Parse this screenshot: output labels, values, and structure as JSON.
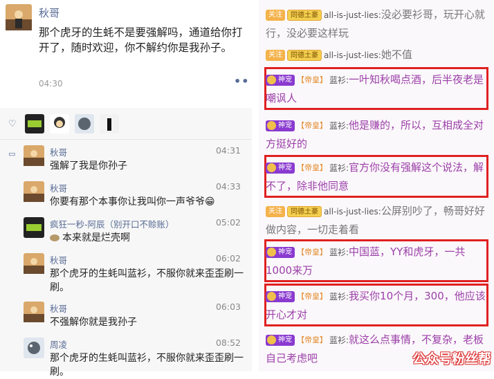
{
  "post": {
    "author": "秋哥",
    "text": "那个虎牙的生蚝不是要强解吗，通道给你打开了，随时欢迎，你不解约你是我孙子。",
    "time": "04:30",
    "more": "••"
  },
  "likes_icon": "heart-icon",
  "comments": [
    {
      "name": "秋哥",
      "time": "04:31",
      "text": "强解了我是你孙子"
    },
    {
      "name": "秋哥",
      "time": "04:33",
      "text": "你要有那个本事你让我叫你一声爷爷😁"
    },
    {
      "name": "疯狂一秒-阿辰（别开口不赊账）",
      "time": "05:02",
      "text": "本来就是烂壳啊"
    },
    {
      "name": "秋哥",
      "time": "06:02",
      "text": "那个虎牙的生蚝叫蓝衫，不服你就来歪歪刷一刷。"
    },
    {
      "name": "秋哥",
      "time": "06:03",
      "text": "不强解你就是我孙子"
    },
    {
      "name": "周凌",
      "time": "08:52",
      "text": "那个虎牙的生蚝叫蓝衫，不服你就来歪歪刷一刷。"
    }
  ],
  "chat": [
    {
      "badges": [
        "关注",
        "同德土豪"
      ],
      "nick": "all-is-just-lies:",
      "text": "没必要衫哥，玩开心就行，没必要这样玩",
      "style": "grey"
    },
    {
      "badges": [
        "关注",
        "同德土豪"
      ],
      "nick": "all-is-just-lies:",
      "text": "她不值",
      "style": "grey"
    },
    {
      "badges": [
        "神宠",
        "【帝皇】"
      ],
      "nick": "蓝衫:",
      "text": "一叶知秋喝点酒，后半夜老是嘲讽人",
      "style": "purple"
    },
    {
      "badges": [
        "神宠",
        "【帝皇】"
      ],
      "nick": "蓝衫:",
      "text": "他是赚的，所以，互相成全对方挺好的",
      "style": "purple"
    },
    {
      "badges": [
        "神宠",
        "【帝皇】"
      ],
      "nick": "蓝衫:",
      "text": "官方你没有强解这个说法，解不了，除非他同意",
      "style": "purple"
    },
    {
      "badges": [
        "关注",
        "同德土豪"
      ],
      "nick": "all-is-just-lies:",
      "text": "公屏别吵了，畅哥好好做内容，一切走着看",
      "style": "grey"
    },
    {
      "badges": [
        "神宠",
        "【帝皇】"
      ],
      "nick": "蓝衫:",
      "text": "中国蓝，YY和虎牙，一共1000来万",
      "style": "purple"
    },
    {
      "badges": [
        "神宠",
        "【帝皇】"
      ],
      "nick": "蓝衫:",
      "text": "我买你10个月，300，他应该开心才对",
      "style": "purple"
    },
    {
      "badges": [
        "神宠",
        "【帝皇】"
      ],
      "nick": "蓝衫:",
      "text": "就这么点事情，不复杂，老板自己考虑吧",
      "style": "purple"
    }
  ],
  "watermark": "公众号粉丝帮",
  "colors": {
    "link": "#576b95",
    "highlight": "#e02020",
    "chat_purple": "#9b3fa8"
  }
}
